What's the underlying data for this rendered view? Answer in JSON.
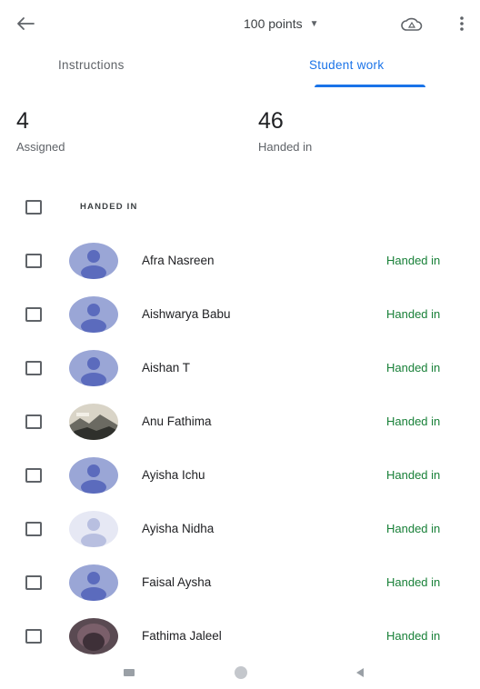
{
  "header": {
    "back_icon": "arrow-back-icon",
    "points_label": "100 points",
    "points_caret_icon": "caret-down-icon",
    "drive_icon": "drive-icon",
    "more_icon": "more-vert-icon"
  },
  "tabs": [
    {
      "label": "Instructions",
      "selected": false
    },
    {
      "label": "Student work",
      "selected": true
    }
  ],
  "stats": {
    "assigned": {
      "count": "4",
      "label": "Assigned"
    },
    "handed_in": {
      "count": "46",
      "label": "Handed in"
    }
  },
  "section": {
    "title": "HANDED IN"
  },
  "students": [
    {
      "name": "Afra Nasreen",
      "status": "Handed in",
      "avatar": "default"
    },
    {
      "name": "Aishwarya Babu",
      "status": "Handed in",
      "avatar": "default"
    },
    {
      "name": "Aishan T",
      "status": "Handed in",
      "avatar": "default"
    },
    {
      "name": "Anu Fathima",
      "status": "Handed in",
      "avatar": "photo-landscape"
    },
    {
      "name": "Ayisha Ichu",
      "status": "Handed in",
      "avatar": "default"
    },
    {
      "name": "Ayisha Nidha",
      "status": "Handed in",
      "avatar": "default-faded"
    },
    {
      "name": "Faisal Aysha",
      "status": "Handed in",
      "avatar": "default"
    },
    {
      "name": "Fathima Jaleel",
      "status": "Handed in",
      "avatar": "photo-dark"
    }
  ],
  "colors": {
    "accent": "#1a73e8",
    "status": "#188038",
    "avatar_bg": "#9aa6d6",
    "avatar_fg": "#5b6bbd"
  },
  "system_nav": [
    "recents-icon",
    "home-icon",
    "back-triangle-icon"
  ]
}
